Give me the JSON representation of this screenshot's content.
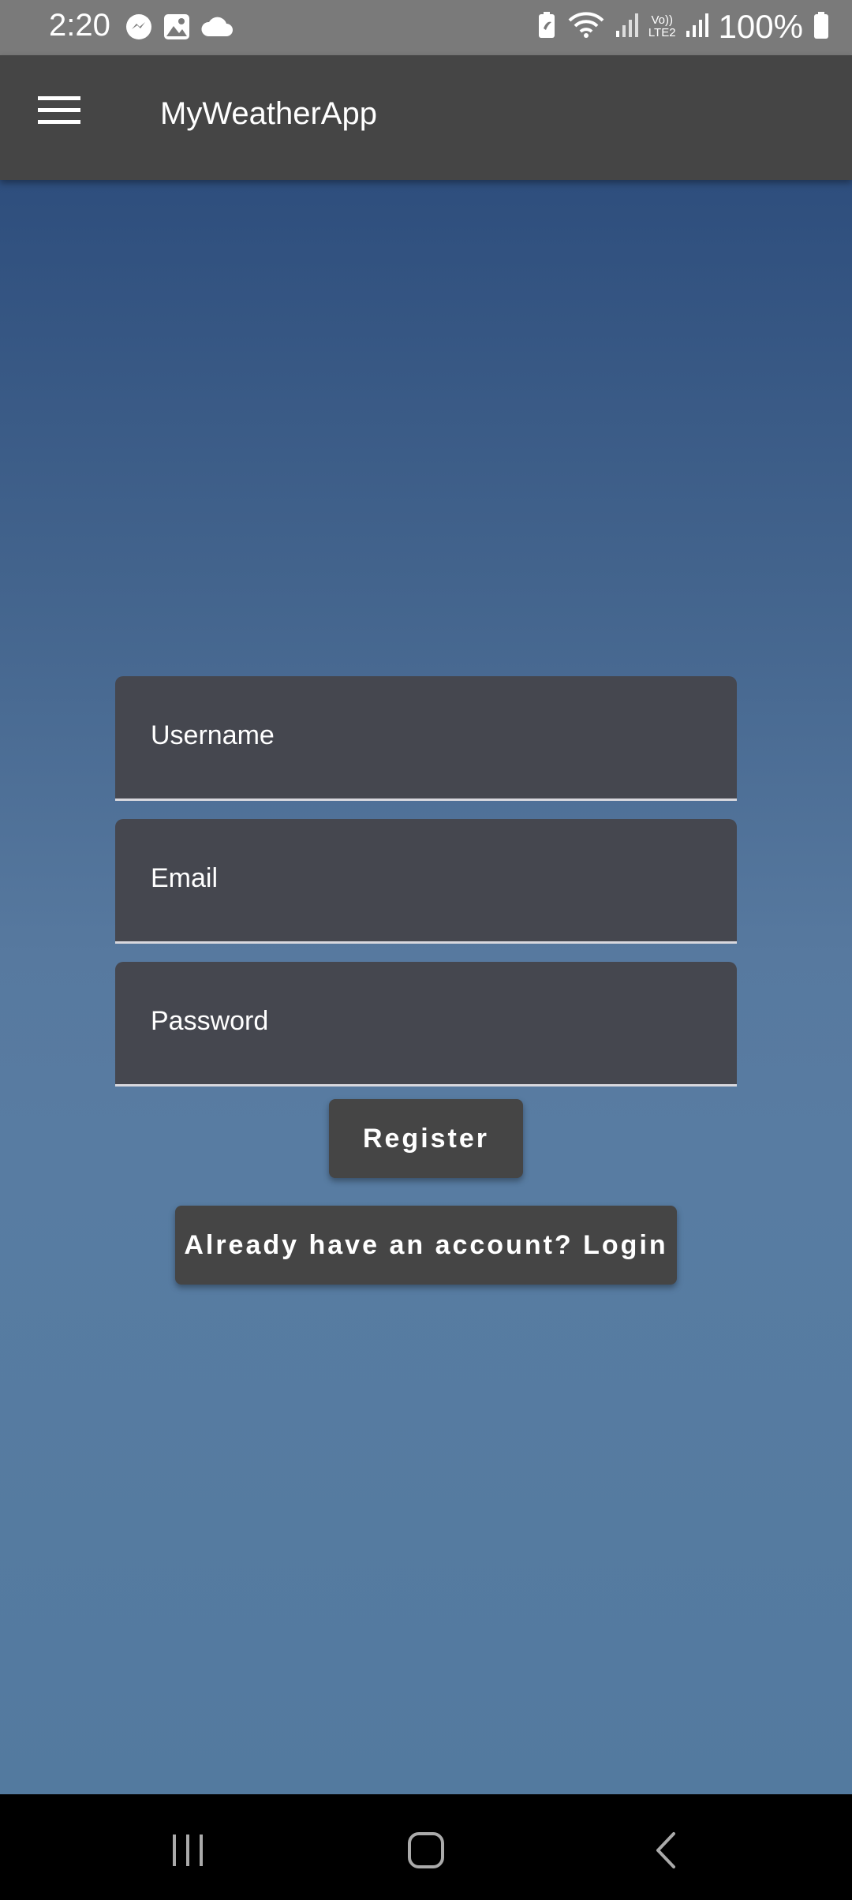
{
  "status_bar": {
    "time": "2:20",
    "battery_text": "100%",
    "network_label_top": "Vo))",
    "network_label_bottom": "LTE2",
    "icons": [
      "messenger-icon",
      "gallery-icon",
      "cloud-icon",
      "battery-saver-icon",
      "wifi-icon",
      "signal-icon",
      "signal-icon",
      "battery-icon"
    ]
  },
  "app_bar": {
    "title": "MyWeatherApp",
    "menu_icon": "hamburger-menu-icon"
  },
  "form": {
    "username_label": "Username",
    "email_label": "Email",
    "password_label": "Password",
    "register_button": "Register",
    "login_button": "Already have an account? Login"
  },
  "nav_bar": {
    "icons": [
      "recent-apps-icon",
      "home-icon",
      "back-icon"
    ]
  },
  "colors": {
    "app_bar": "#454545",
    "field_bg": "#45474f",
    "button_bg": "#454545",
    "gradient_top": "#2e4e7d",
    "gradient_bottom": "#537a9f"
  }
}
